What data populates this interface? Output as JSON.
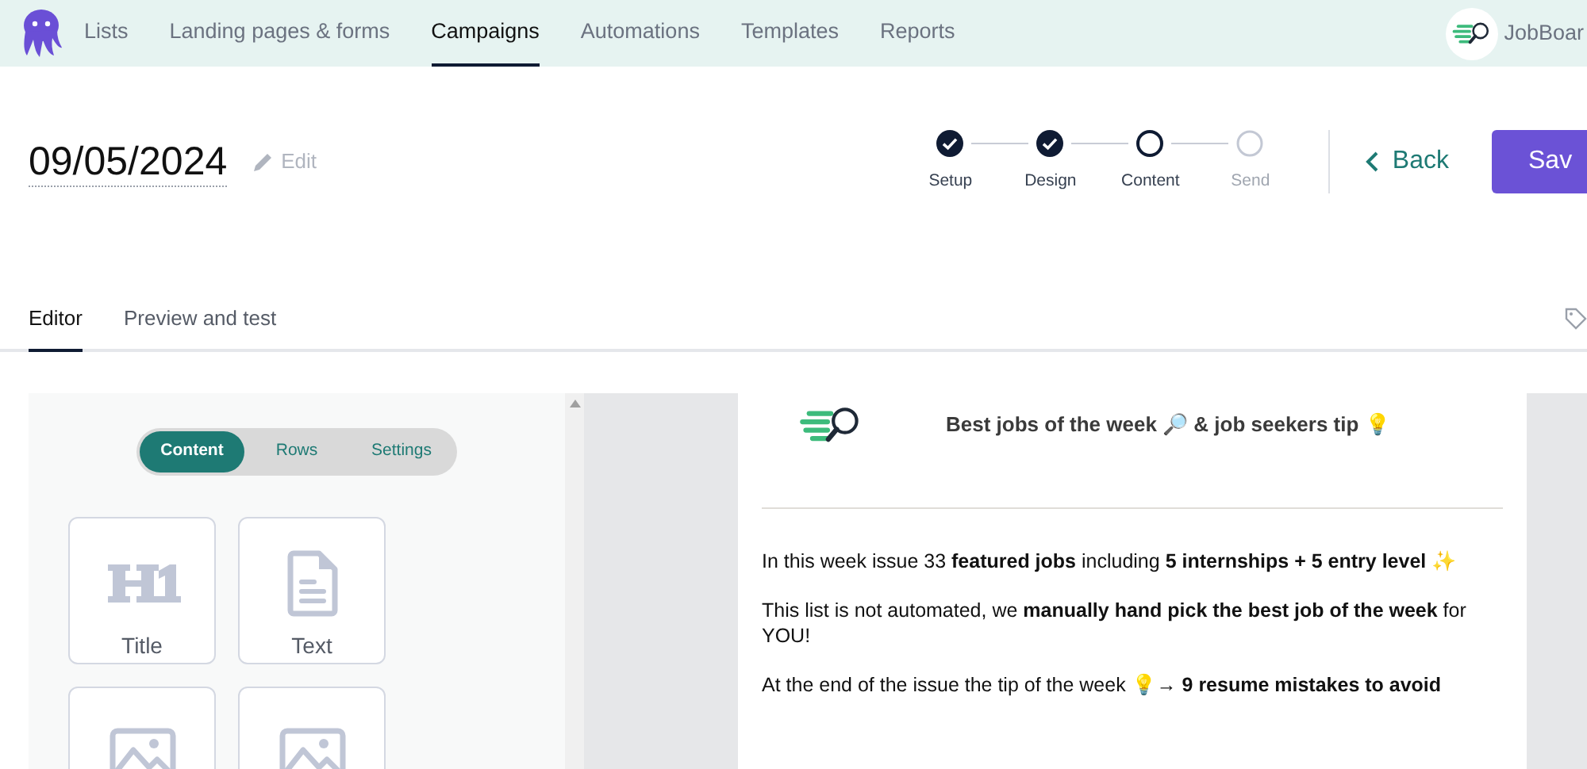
{
  "nav": {
    "items": [
      {
        "label": "Lists",
        "selected": false
      },
      {
        "label": "Landing pages & forms",
        "selected": false
      },
      {
        "label": "Campaigns",
        "selected": true
      },
      {
        "label": "Automations",
        "selected": false
      },
      {
        "label": "Templates",
        "selected": false
      },
      {
        "label": "Reports",
        "selected": false
      }
    ],
    "account": "JobBoar"
  },
  "campaign": {
    "title": "09/05/2024",
    "edit": "Edit"
  },
  "steps": [
    {
      "label": "Setup",
      "kind": "done"
    },
    {
      "label": "Design",
      "kind": "done"
    },
    {
      "label": "Content",
      "kind": "current"
    },
    {
      "label": "Send",
      "kind": "pending"
    }
  ],
  "back": "Back",
  "save": "Sav",
  "tabs": [
    {
      "label": "Editor",
      "selected": true
    },
    {
      "label": "Preview and test",
      "selected": false
    }
  ],
  "panel": {
    "segments": [
      {
        "label": "Content",
        "selected": true
      },
      {
        "label": "Rows",
        "selected": false
      },
      {
        "label": "Settings",
        "selected": false
      }
    ],
    "blocks": [
      {
        "label": "Title",
        "kind": "title"
      },
      {
        "label": "Text",
        "kind": "text"
      },
      {
        "kind": "image"
      },
      {
        "kind": "image"
      }
    ]
  },
  "email": {
    "heading": "Best jobs of the week 🔎 & job seekers tip 💡",
    "paragraphs": [
      "In this week issue 33 **featured jobs** including **5 internships + 5 entry level** ✨",
      "This list is not automated, we **manually hand pick the best job of the week** for YOU!",
      "At the end of the issue the tip of the week 💡→ **9 resume mistakes to avoid**"
    ]
  }
}
